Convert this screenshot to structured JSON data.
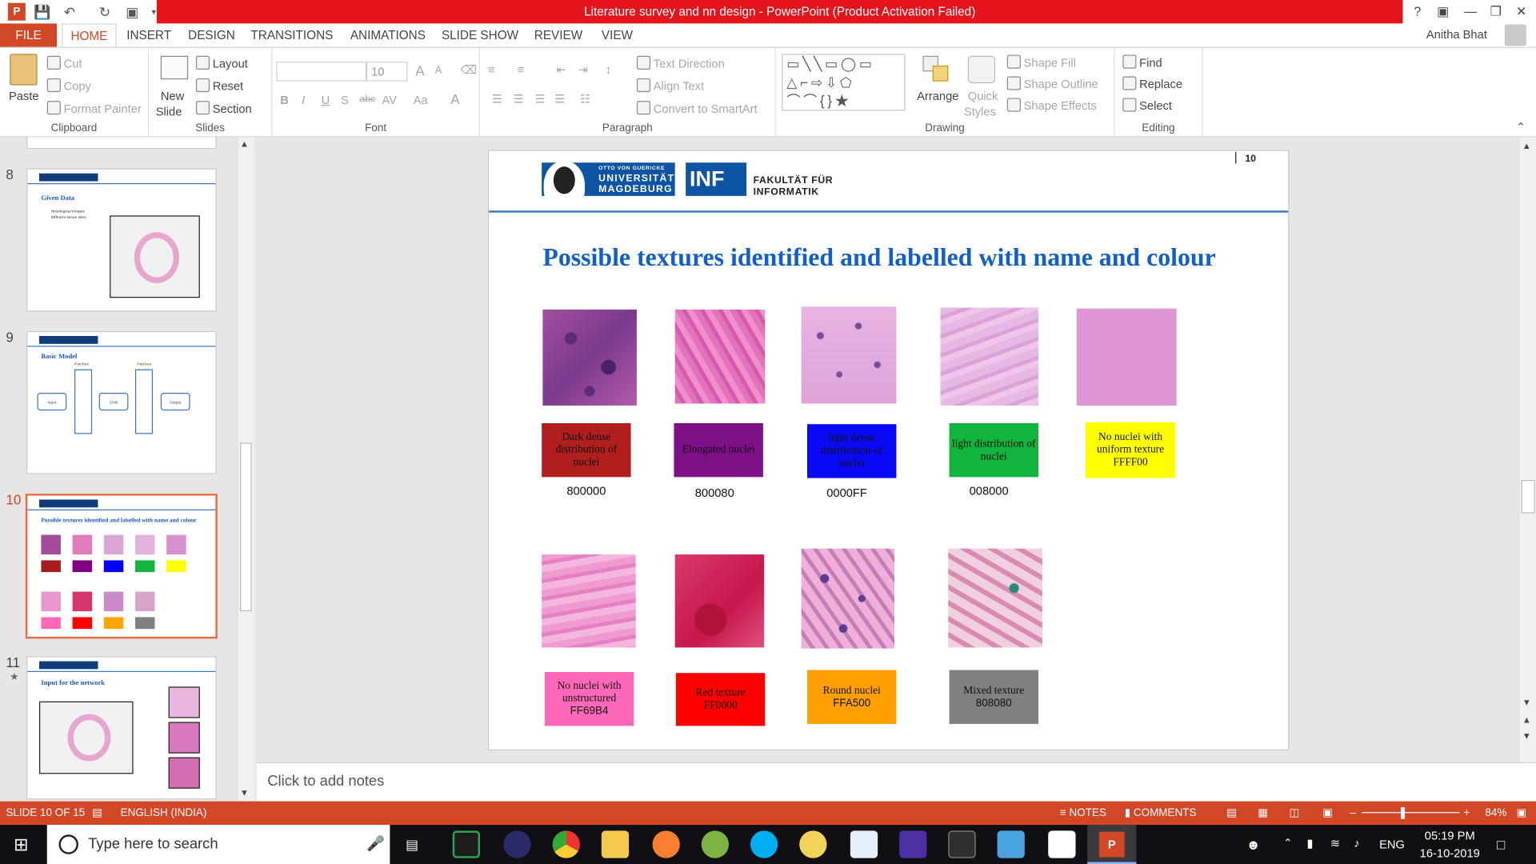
{
  "window": {
    "title": "Literature survey and nn design -  PowerPoint (Product Activation Failed)",
    "help": "?",
    "user": "Anitha Bhat"
  },
  "tabs": [
    "FILE",
    "HOME",
    "INSERT",
    "DESIGN",
    "TRANSITIONS",
    "ANIMATIONS",
    "SLIDE SHOW",
    "REVIEW",
    "VIEW"
  ],
  "ribbon": {
    "clipboard": {
      "paste": "Paste",
      "cut": "Cut",
      "copy": "Copy",
      "format_painter": "Format Painter",
      "label": "Clipboard"
    },
    "slides": {
      "new_slide": "New",
      "new_slide2": "Slide",
      "layout": "Layout",
      "reset": "Reset",
      "section": "Section",
      "label": "Slides"
    },
    "font": {
      "size": "10",
      "label": "Font",
      "bold": "B",
      "italic": "I",
      "underline": "U",
      "shadow": "S",
      "strike": "abc",
      "spacing": "AV",
      "case": "Aa",
      "color": "A",
      "grow": "A",
      "shrink": "A"
    },
    "paragraph": {
      "text_direction": "Text Direction",
      "align_text": "Align Text",
      "smartart": "Convert to SmartArt",
      "label": "Paragraph"
    },
    "drawing": {
      "arrange": "Arrange",
      "quick_styles": "Quick",
      "quick_styles2": "Styles",
      "shape_fill": "Shape Fill",
      "shape_outline": "Shape Outline",
      "shape_effects": "Shape Effects",
      "label": "Drawing"
    },
    "editing": {
      "find": "Find",
      "replace": "Replace",
      "select": "Select",
      "label": "Editing"
    }
  },
  "thumbnails": [
    {
      "num": "8",
      "title": "Given Data",
      "bullets": [
        "Histological images",
        "Different tissue sites"
      ]
    },
    {
      "num": "9",
      "title": "Basic Model",
      "labels": [
        "Input",
        "CNN",
        "Output",
        "Patches",
        "Patches"
      ]
    },
    {
      "num": "10",
      "title": "Possible textures identified and labelled with name and colour"
    },
    {
      "num": "11",
      "title": "Input for the network"
    }
  ],
  "slide": {
    "page_number": "10",
    "logo_university": "OTTO VON GUERICKE UNIVERSITÄT MAGDEBURG",
    "logo_uni_line1": "OTTO VON GUERICKE",
    "logo_uni_line2": "UNIVERSITÄT",
    "logo_uni_line3": "MAGDEBURG",
    "logo_inf": "INF",
    "logo_fak1": "FAKULTÄT FÜR",
    "logo_fak2": "INFORMATIK",
    "title": "Possible textures identified and labelled with name and colour",
    "textures": [
      {
        "label": "Dark dense distribution of nuclei",
        "code": "800000",
        "color": "#b01e1e"
      },
      {
        "label": "Elongated nuclei",
        "code": "800080",
        "color": "#7f0f86"
      },
      {
        "label": "light dense distribution of nuclei",
        "code": "0000FF",
        "color": "#0a0af6"
      },
      {
        "label": "light distribution of nuclei",
        "code": "008000",
        "color": "#11b43c"
      },
      {
        "label": "No nuclei with uniform texture",
        "code": "FFFF00",
        "color": "#ffff00"
      },
      {
        "label": "No nuclei with unstructured",
        "code": "FF69B4",
        "color": "#ff68b9"
      },
      {
        "label": "Red texture",
        "code": "FF0000",
        "color": "#fe0000"
      },
      {
        "label": "Round nuclei",
        "code": "FFA500",
        "color": "#ffa000"
      },
      {
        "label": "Mixed texture",
        "code": "808080",
        "color": "#808080"
      }
    ]
  },
  "notes_placeholder": "Click to add notes",
  "status": {
    "slide": "SLIDE 10 OF 15",
    "language": "ENGLISH (INDIA)",
    "notes": "NOTES",
    "comments": "COMMENTS",
    "zoom": "84%"
  },
  "taskbar": {
    "search": "Type here to search",
    "lang": "ENG",
    "time": "05:19 PM",
    "date": "16-10-2019"
  }
}
